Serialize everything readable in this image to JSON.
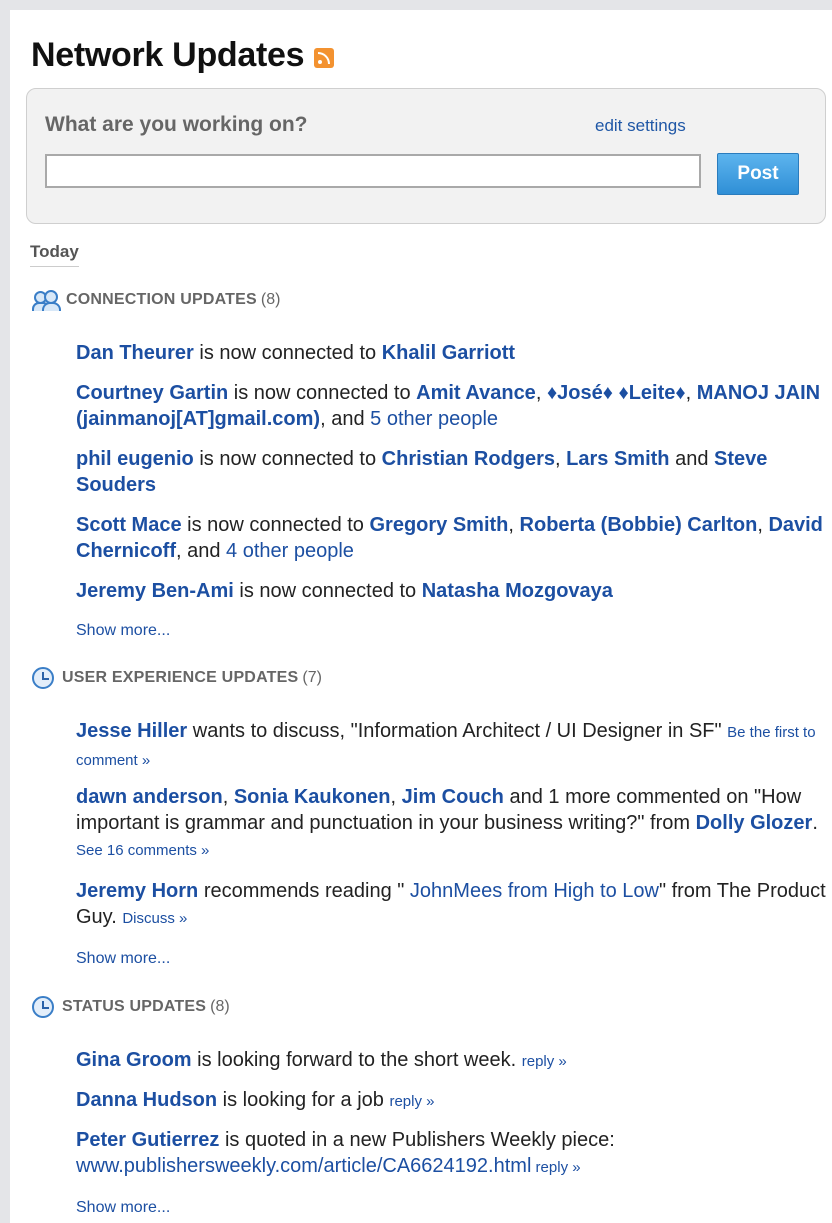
{
  "header": {
    "title": "Network Updates"
  },
  "status_box": {
    "prompt": "What are you working on?",
    "edit_settings": "edit settings",
    "input_value": "",
    "post_label": "Post"
  },
  "today_label": "Today",
  "connections": {
    "title": "CONNECTION UPDATES",
    "count": "(8)",
    "items": [
      {
        "a": "Dan Theurer",
        "t1": " is now connected to ",
        "b": "Khalil Garriott"
      },
      {
        "a": "Courtney Gartin",
        "t1": " is now connected to ",
        "b": "Amit Avance",
        "sep1": ", ",
        "c": "♦José♦ ♦Leite♦",
        "sep2": ", ",
        "d": "MANOJ JAIN (jainmanoj[AT]gmail.com)",
        "t2": ", and ",
        "e": "5 other people"
      },
      {
        "a": "phil eugenio",
        "t1": " is now connected to ",
        "b": "Christian Rodgers",
        "sep1": ", ",
        "c": "Lars Smith",
        "t2": " and ",
        "d": "Steve Souders"
      },
      {
        "a": "Scott Mace",
        "t1": " is now connected to ",
        "b": "Gregory Smith",
        "sep1": ", ",
        "c": "Roberta (Bobbie) Carlton",
        "sep2": ", ",
        "d": "David Chernicoff",
        "t2": ", and ",
        "e": "4 other people"
      },
      {
        "a": "Jeremy Ben-Ami",
        "t1": " is now connected to ",
        "b": "Natasha Mozgovaya"
      }
    ],
    "show_more": "Show more..."
  },
  "ux": {
    "title": "USER EXPERIENCE UPDATES",
    "count": "(7)",
    "items": [
      {
        "a": "Jesse Hiller",
        "t1": " wants to discuss, \"Information Architect / UI Designer in SF\" ",
        "link": "Be the first to comment »"
      },
      {
        "a": "dawn anderson",
        "sep1": ", ",
        "b": "Sonia Kaukonen",
        "sep2": ", ",
        "c": "Jim Couch",
        "t1": " and 1 more commented on \"How important is grammar and punctuation in your business writing?\" from ",
        "d": "Dolly Glozer",
        "t2": ". ",
        "link": "See 16 comments »"
      },
      {
        "a": "Jeremy Horn",
        "t1": " recommends reading \"",
        "b": " JohnMees from High to Low",
        "t2": "\" from The Product Guy. ",
        "link": "Discuss »"
      }
    ],
    "show_more": "Show more..."
  },
  "status": {
    "title": "STATUS UPDATES",
    "count": "(8)",
    "items": [
      {
        "a": "Gina Groom",
        "t1": " is looking forward to the short week. ",
        "link": "reply »"
      },
      {
        "a": "Danna Hudson",
        "t1": " is looking for a job ",
        "link": "reply »"
      },
      {
        "a": "Peter Gutierrez",
        "t1": " is quoted in a new Publishers Weekly piece: ",
        "url": "www.publishersweekly.com/article/CA6624192.html",
        "link": " reply »"
      }
    ],
    "show_more": "Show more..."
  }
}
